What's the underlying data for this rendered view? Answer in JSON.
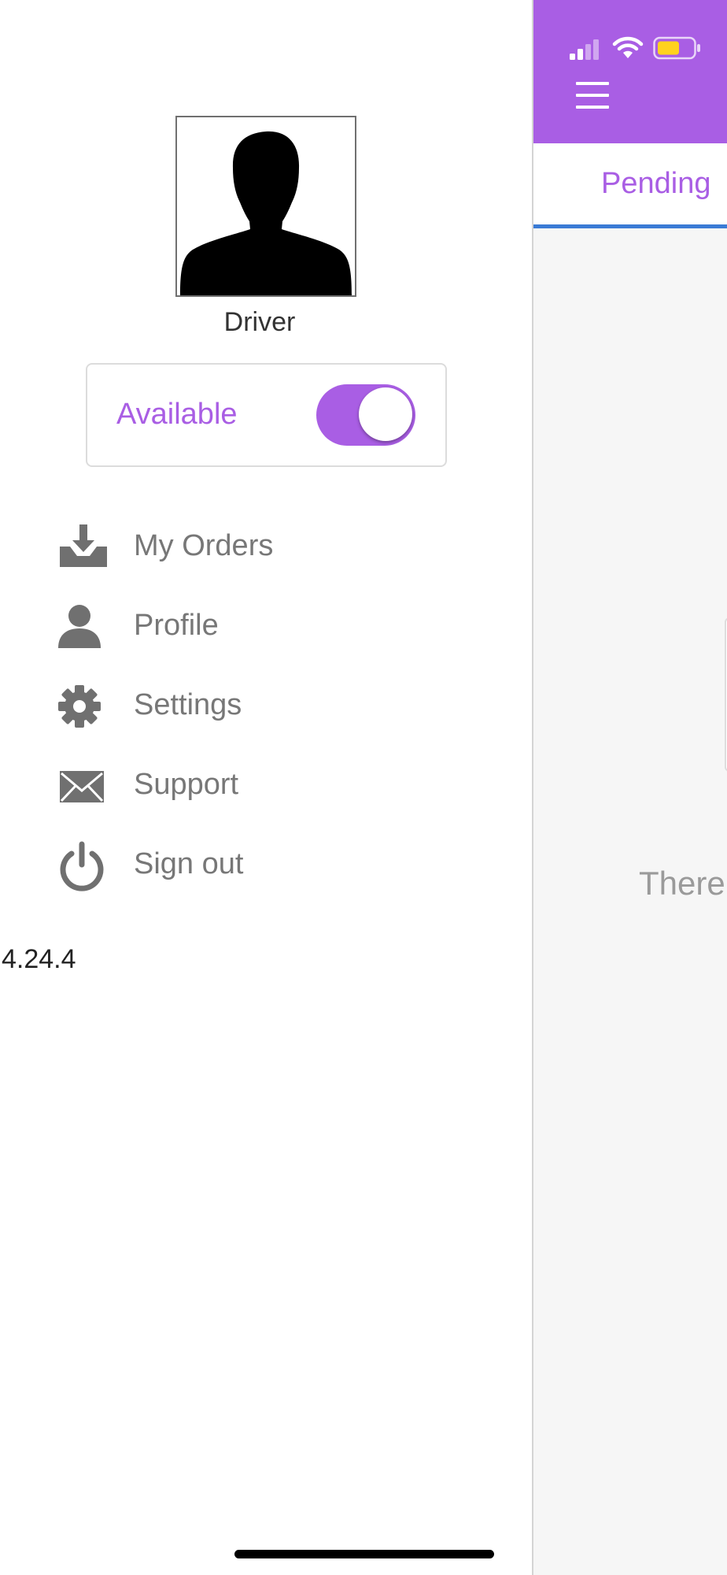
{
  "drawer": {
    "user_name": "Driver",
    "availability": {
      "label": "Available",
      "enabled": true
    },
    "menu_items": [
      {
        "label": "My Orders",
        "icon": "download-tray-icon"
      },
      {
        "label": "Profile",
        "icon": "person-icon"
      },
      {
        "label": "Settings",
        "icon": "gear-icon"
      },
      {
        "label": "Support",
        "icon": "envelope-icon"
      },
      {
        "label": "Sign out",
        "icon": "power-icon"
      }
    ],
    "version": "4.24.4"
  },
  "main": {
    "active_tab": "Pending",
    "empty_message": "There"
  },
  "status_bar": {
    "signal": "cellular-signal-icon",
    "wifi": "wifi-icon",
    "battery": "battery-icon"
  },
  "colors": {
    "accent": "#a95ee4",
    "tab_indicator": "#3a7bd5",
    "battery_fill": "#ffd21e"
  }
}
